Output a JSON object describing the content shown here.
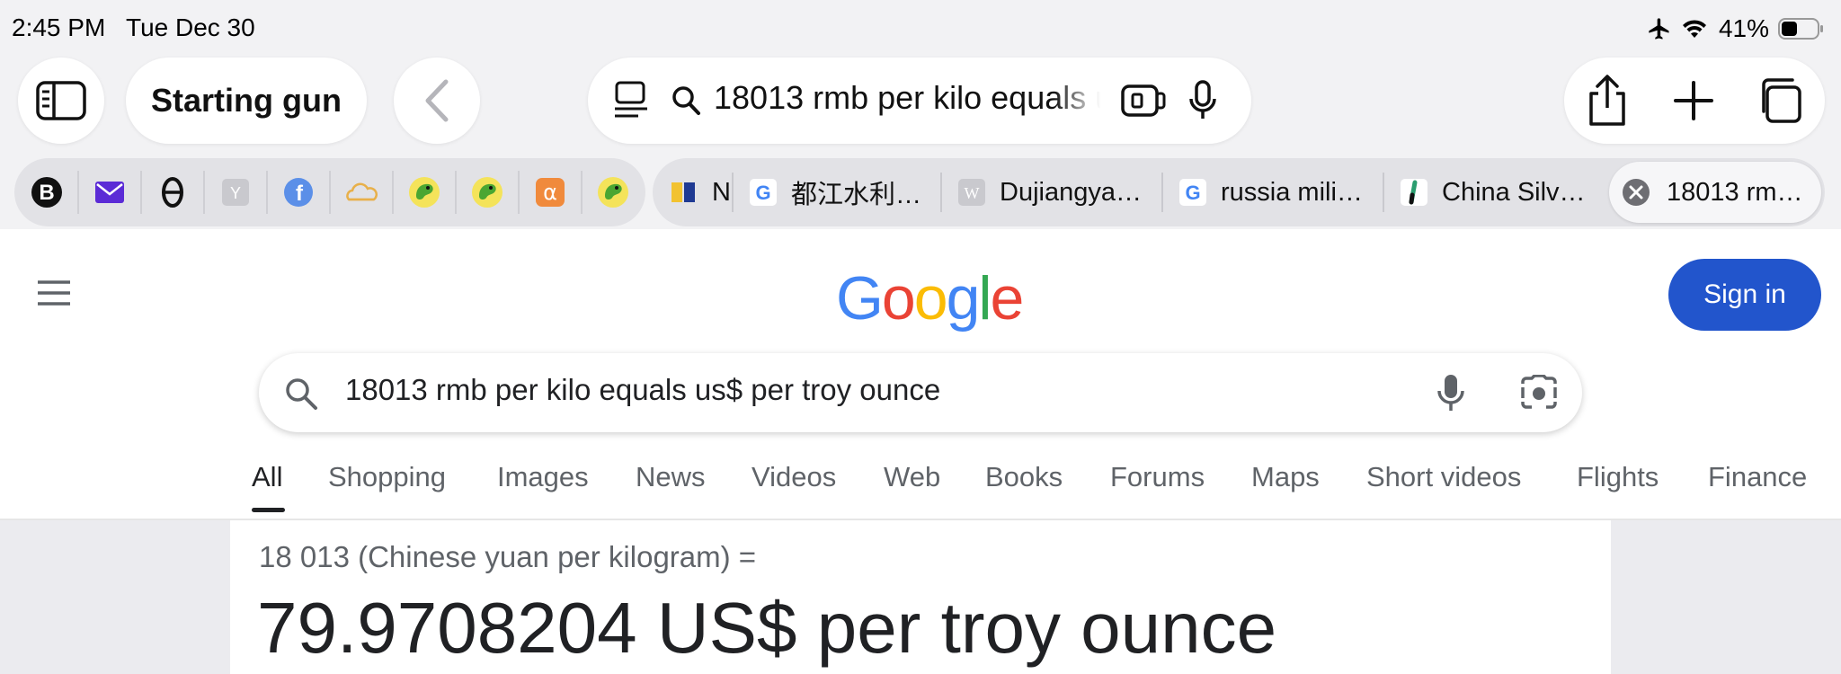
{
  "status_bar": {
    "time": "2:45 PM",
    "date": "Tue Dec 30",
    "battery": "41%"
  },
  "toolbar": {
    "tab_group": "Starting gun",
    "address": "18013 rmb per kilo equals us$ per troy ounce"
  },
  "favorites": [
    {
      "icon": "b-circle-icon"
    },
    {
      "icon": "mail-icon"
    },
    {
      "icon": "theta-icon"
    },
    {
      "icon": "y-icon"
    },
    {
      "icon": "f-circle-icon"
    },
    {
      "icon": "cloud-icon"
    },
    {
      "icon": "parrot-icon"
    },
    {
      "icon": "parrot-icon"
    },
    {
      "icon": "alpha-icon"
    },
    {
      "icon": "parrot-icon"
    }
  ],
  "tabs": [
    {
      "title": "N"
    },
    {
      "title": "都江水利…"
    },
    {
      "title": "Dujiangya…"
    },
    {
      "title": "russia mili…"
    },
    {
      "title": "China Silv…"
    },
    {
      "title": "18013 rm…"
    }
  ],
  "google": {
    "logo": "Google",
    "sign_in": "Sign in",
    "query": "18013 rmb per kilo equals us$ per troy ounce",
    "nav_tabs": [
      "All",
      "Shopping",
      "Images",
      "News",
      "Videos",
      "Web",
      "Books",
      "Forums",
      "Maps",
      "Short videos",
      "Flights",
      "Finance"
    ],
    "active_tab": "All",
    "conversion_label": "18 013 (Chinese yuan per kilogram) =",
    "conversion_result": "79.9708204 US$ per troy ounce"
  },
  "colors": {
    "sign_in_bg": "#2255cc",
    "google_blue": "#4285F4",
    "google_red": "#EA4335",
    "google_yellow": "#FBBC05",
    "google_green": "#34A853"
  }
}
